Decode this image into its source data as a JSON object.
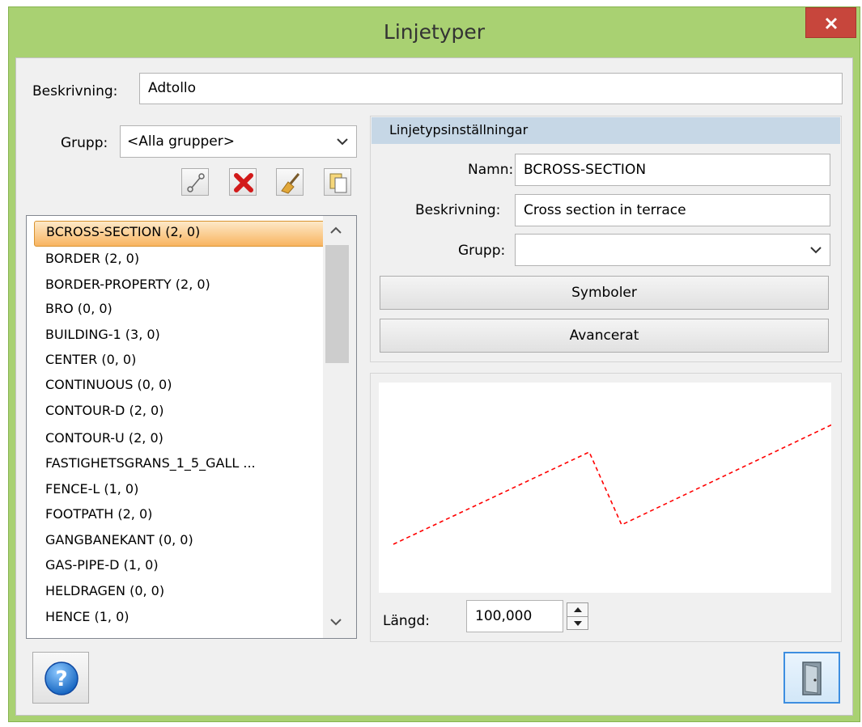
{
  "window": {
    "title": "Linjetyper"
  },
  "top": {
    "description_label": "Beskrivning:",
    "description_value": "Adtollo"
  },
  "left": {
    "group_label": "Grupp:",
    "group_value": "<Alla grupper>",
    "toolbar_icons": [
      "line-icon",
      "delete-icon",
      "broom-icon",
      "copy-icon"
    ],
    "linetypes": [
      "BCROSS-SECTION (2, 0)",
      "BORDER (2, 0)",
      "BORDER-PROPERTY (2, 0)",
      "BRO (0, 0)",
      "BUILDING-1 (3, 0)",
      "CENTER (0, 0)",
      "CONTINUOUS (0, 0)",
      "CONTOUR-D (2, 0)",
      "CONTOUR-U (2, 0)",
      "FASTIGHETSGRANS_1_5_GALL ...",
      "FENCE-L (1, 0)",
      "FOOTPATH (2, 0)",
      "GANGBANEKANT (0, 0)",
      "GAS-PIPE-D (1, 0)",
      "HELDRAGEN (0, 0)",
      "HENCE (1, 0)"
    ],
    "selected_index": 0
  },
  "settings": {
    "header": "Linjetypsinställningar",
    "name_label": "Namn:",
    "name_value": "BCROSS-SECTION",
    "description_label": "Beskrivning:",
    "description_value": "Cross section in terrace",
    "group_label": "Grupp:",
    "group_value": "",
    "symbols_button": "Symboler",
    "advanced_button": "Avancerat"
  },
  "preview": {
    "line_color": "#ff0000",
    "length_label": "Längd:",
    "length_value": "100,000"
  },
  "footer": {
    "help_icon": "help-icon",
    "exit_icon": "door-exit-icon"
  },
  "colors": {
    "frame": "#a9d172",
    "close": "#c7463c",
    "selection": "#f8b460",
    "header": "#c6d7e6"
  }
}
